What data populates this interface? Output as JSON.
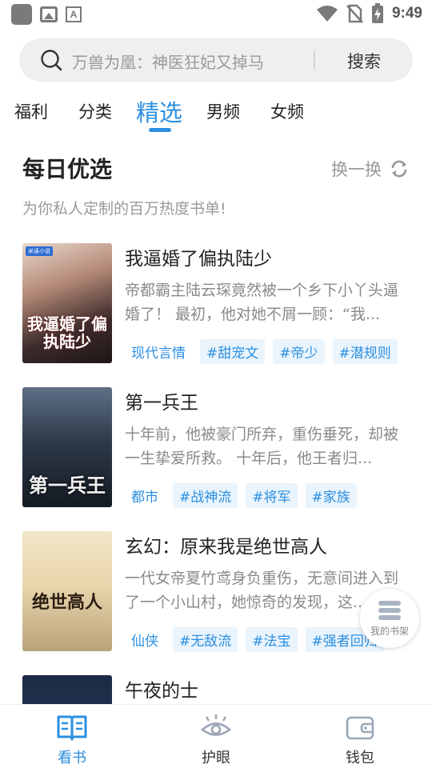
{
  "status_bar": {
    "time": "9:49",
    "left_icons": [
      "app-icon",
      "image-icon",
      "text-icon"
    ],
    "right_icons": [
      "wifi-icon",
      "no-sim-icon",
      "battery-icon"
    ]
  },
  "search": {
    "placeholder": "万兽为凰：神医狂妃又掉马",
    "button_label": "搜索"
  },
  "tabs": {
    "items": [
      {
        "label": "福利"
      },
      {
        "label": "分类"
      },
      {
        "label": "精选"
      },
      {
        "label": "男频"
      },
      {
        "label": "女频"
      }
    ],
    "active": "精选"
  },
  "section": {
    "title": "每日优选",
    "refresh_label": "换一换",
    "subtitle": "为你私人定制的百万热度书单!"
  },
  "books": [
    {
      "title": "我逼婚了偏执陆少",
      "description": "帝都霸主陆云琛竟然被一个乡下小丫头逼婚了！ 最初，他对她不屑一顾：“我...",
      "category": "现代言情",
      "tags": [
        "#甜宠文",
        "#帝少",
        "#潜规则"
      ],
      "cover_text": "我逼婚了偏执陆少",
      "cover_badge": "米读小说"
    },
    {
      "title": "第一兵王",
      "description": "十年前，他被豪门所弃，重伤垂死，却被一生挚爱所救。 十年后，他王者归...",
      "category": "都市",
      "tags": [
        "#战神流",
        "#将军",
        "#家族"
      ],
      "cover_text": "第一兵王"
    },
    {
      "title": "玄幻：原来我是绝世高人",
      "description": "一代女帝夏竹鸢身负重伤，无意间进入到了一个小山村，她惊奇的发现，这...",
      "category": "仙侠",
      "tags": [
        "#无敌流",
        "#法宝",
        "#强者回归"
      ],
      "cover_text": "绝世高人"
    },
    {
      "title": "午夜的士",
      "description": "",
      "category": "",
      "tags": [],
      "cover_text": ""
    }
  ],
  "floating_shelf": {
    "label": "我的书架"
  },
  "bottom_nav": {
    "items": [
      {
        "label": "看书"
      },
      {
        "label": "护眼"
      },
      {
        "label": "钱包"
      }
    ],
    "active": "看书"
  },
  "colors": {
    "accent": "#2b8fe0",
    "tag_bg": "#eaf4fd",
    "muted_text": "#9a9a9a"
  }
}
